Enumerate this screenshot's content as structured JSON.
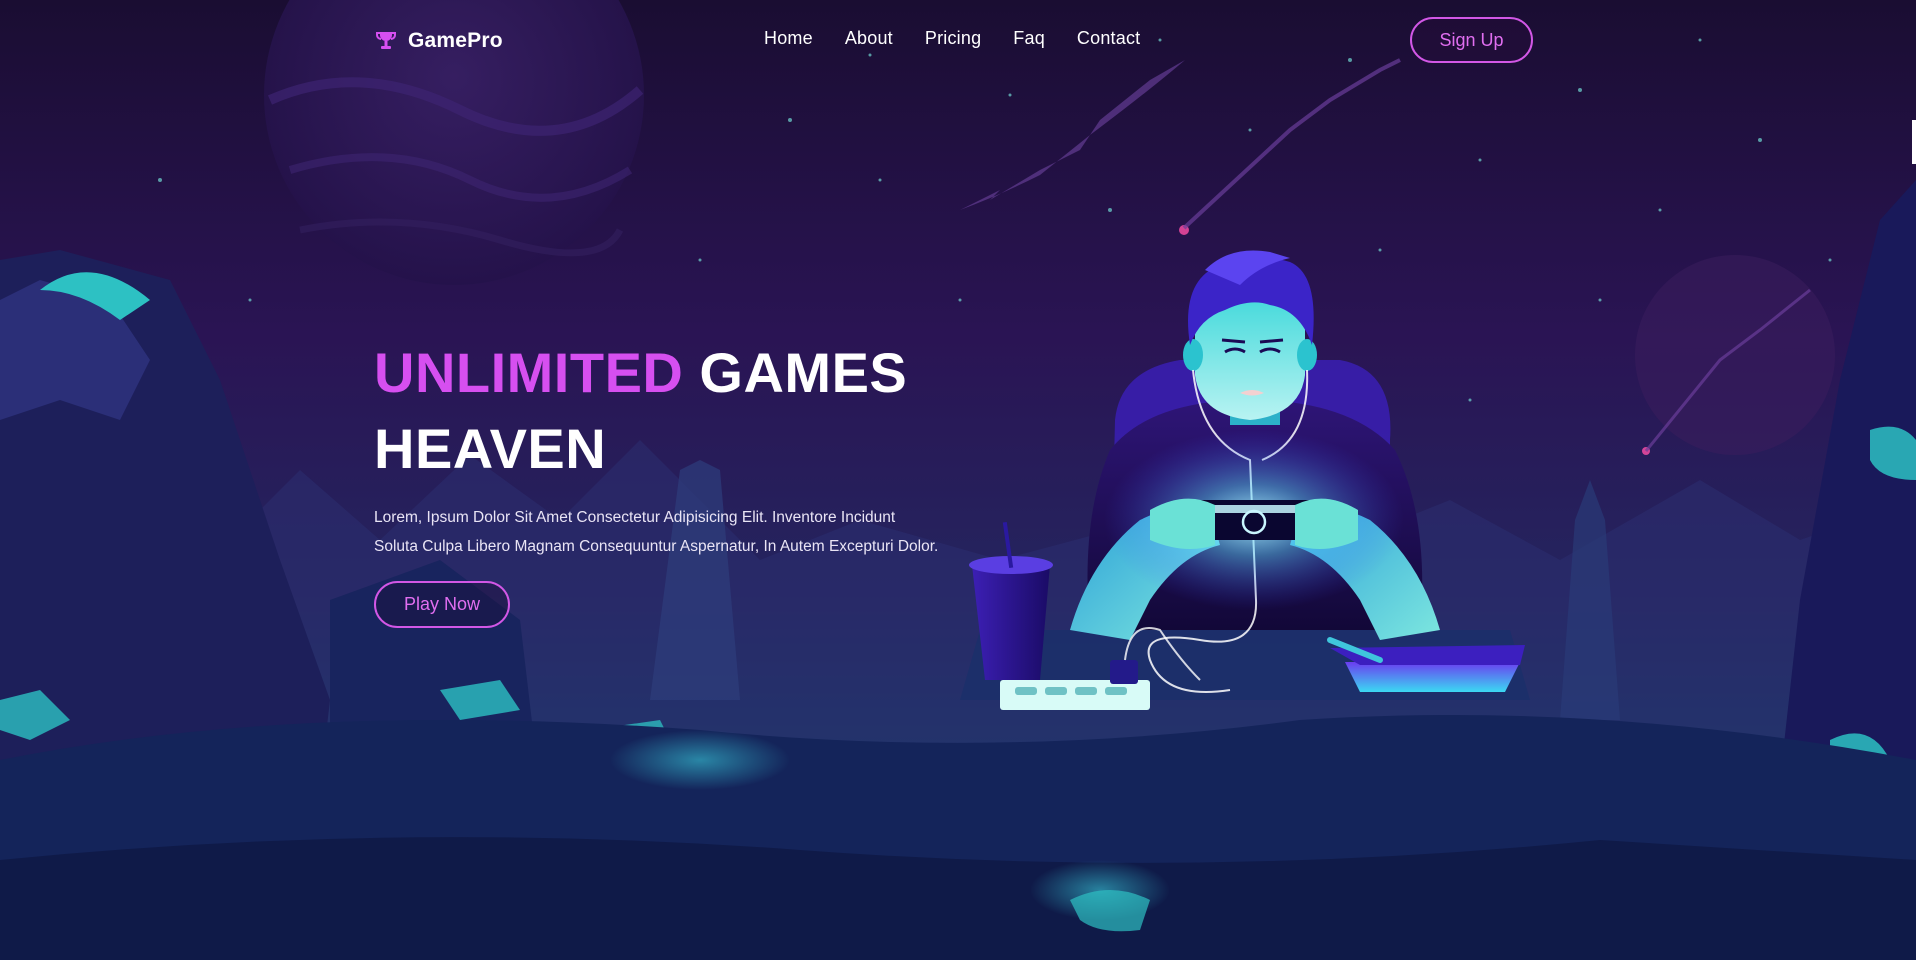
{
  "brand": {
    "name": "GamePro",
    "icon": "trophy-icon"
  },
  "nav": {
    "links": [
      "Home",
      "About",
      "Pricing",
      "Faq",
      "Contact"
    ],
    "signup_label": "Sign Up"
  },
  "hero": {
    "title_accent": "UNLIMITED",
    "title_rest_line1": "GAMES",
    "title_line2": "HEAVEN",
    "description_line1": "Lorem, Ipsum Dolor Sit Amet Consectetur Adipisicing Elit. Inventore Incidunt",
    "description_line2": "Soluta Culpa Libero Magnam Consequuntur Aspernatur, In Autem Excepturi Dolor.",
    "cta_label": "Play Now"
  },
  "colors": {
    "accent": "#d64ff0",
    "button_border": "#d257e6",
    "sky_top": "#1a0d33",
    "ground": "#13335a",
    "glow_teal": "#2dd3c6"
  }
}
